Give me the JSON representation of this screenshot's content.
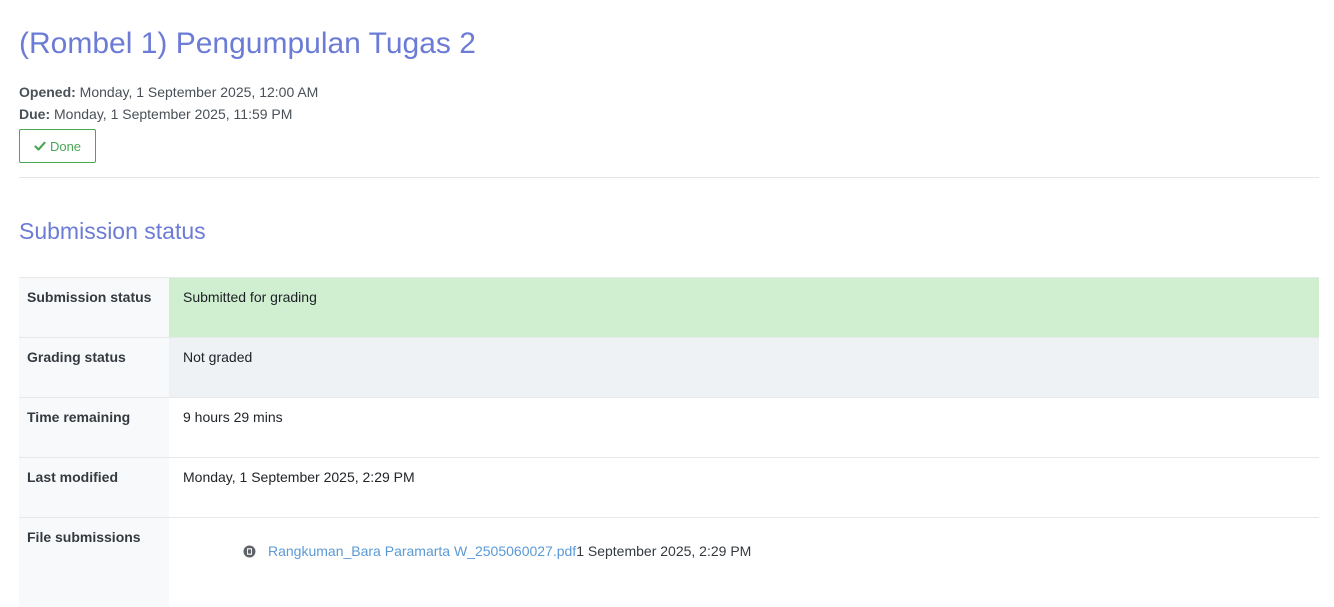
{
  "page_title": "(Rombel 1) Pengumpulan Tugas 2",
  "dates": {
    "opened_label": "Opened:",
    "opened_value": "Monday, 1 September 2025, 12:00 AM",
    "due_label": "Due:",
    "due_value": "Monday, 1 September 2025, 11:59 PM"
  },
  "done_button": {
    "label": "Done",
    "icon": "check-icon"
  },
  "section_title": "Submission status",
  "rows": [
    {
      "label": "Submission status",
      "value": "Submitted for grading"
    },
    {
      "label": "Grading status",
      "value": "Not graded"
    },
    {
      "label": "Time remaining",
      "value": "9 hours 29 mins"
    },
    {
      "label": "Last modified",
      "value": "Monday, 1 September 2025, 2:29 PM"
    },
    {
      "label": "File submissions"
    }
  ],
  "file": {
    "name": "Rangkuman_Bara Paramarta W_2505060027.pdf",
    "date": "1 September 2025, 2:29 PM",
    "icon": "file-icon"
  },
  "colors": {
    "title": "#6b7bd6",
    "done_green": "#4aa655",
    "submitted_bg": "#d0eed0",
    "grading_bg": "#eff2f4",
    "link": "#5b9ad6"
  }
}
